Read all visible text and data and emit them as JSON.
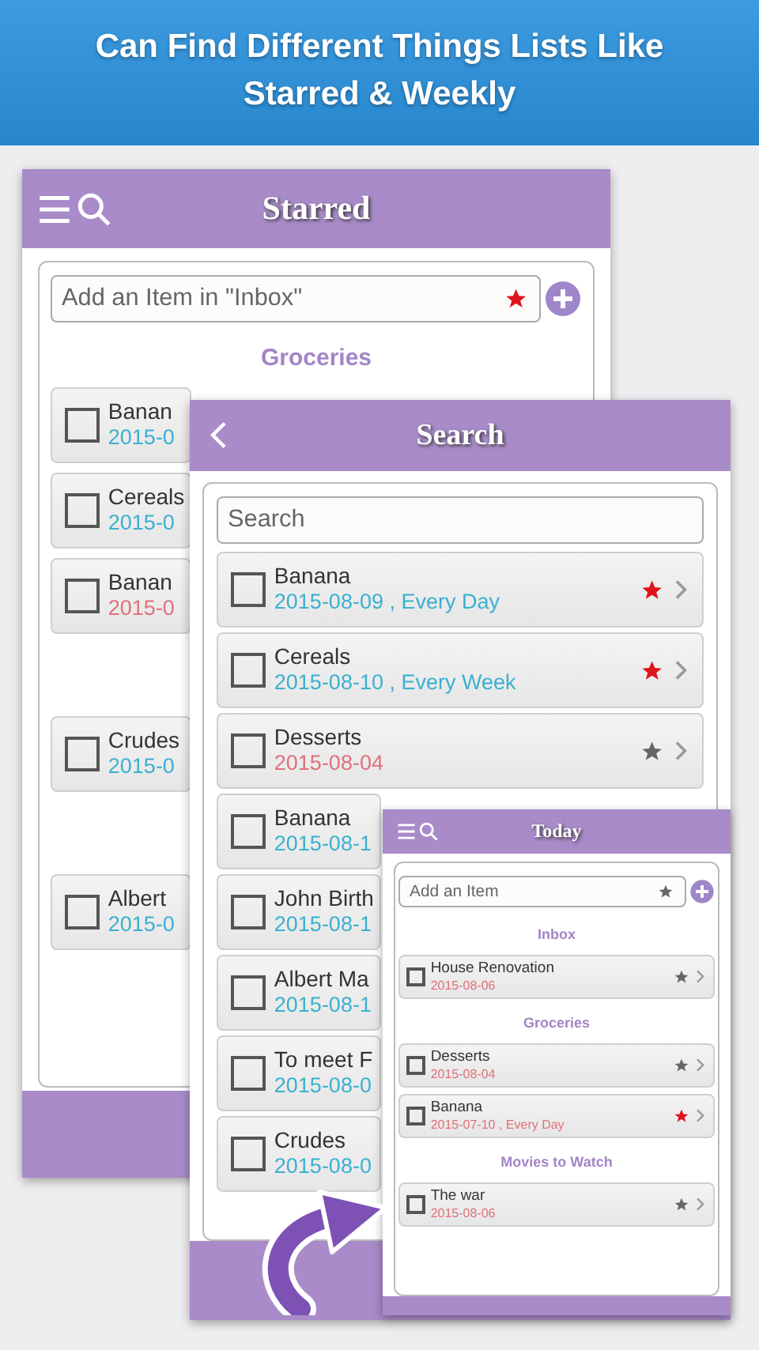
{
  "banner": {
    "lines": [
      "Can Find Different Things Lists Like",
      "Starred & Weekly"
    ]
  },
  "starred_screen": {
    "kind": "menu",
    "title": "Starred",
    "add_field": {
      "placeholder": "Add an Item in \"Inbox\"",
      "starred": true
    },
    "sections": [
      {
        "heading": "Groceries",
        "items": [
          {
            "title": "Banan",
            "date": "2015-0",
            "overdue": false,
            "checked": false
          },
          {
            "title": "Cereals",
            "date": "2015-0",
            "overdue": false,
            "checked": false
          },
          {
            "title": "Banan",
            "date": "2015-0",
            "overdue": true,
            "checked": false
          }
        ]
      },
      {
        "items": [
          {
            "title": "Crudes",
            "date": "2015-0",
            "overdue": false,
            "checked": false
          }
        ]
      },
      {
        "items": [
          {
            "title": "Albert",
            "date": "2015-0",
            "overdue": false,
            "checked": false
          }
        ]
      }
    ]
  },
  "search_screen": {
    "kind": "back",
    "title": "Search",
    "search_field": {
      "placeholder": "Search"
    },
    "sections": [
      {
        "items": [
          {
            "title": "Banana",
            "date": "2015-08-09 , Every Day",
            "overdue": false,
            "checked": false,
            "starred": true
          },
          {
            "title": "Cereals",
            "date": "2015-08-10 , Every Week",
            "overdue": false,
            "checked": false,
            "starred": true
          },
          {
            "title": "Desserts",
            "date": "2015-08-04",
            "overdue": true,
            "checked": false,
            "starred": false
          },
          {
            "title": "Banana",
            "date": "2015-08-1",
            "overdue": false,
            "checked": false
          },
          {
            "title": "John Birth",
            "date": "2015-08-1",
            "overdue": false,
            "checked": false
          },
          {
            "title": "Albert Ma",
            "date": "2015-08-1",
            "overdue": false,
            "checked": false
          },
          {
            "title": "To meet F",
            "date": "2015-08-0",
            "overdue": false,
            "checked": false
          },
          {
            "title": "Crudes",
            "date": "2015-08-0",
            "overdue": false,
            "checked": false
          }
        ]
      }
    ]
  },
  "today_screen": {
    "kind": "menu",
    "title": "Today",
    "add_field": {
      "placeholder": "Add an Item",
      "starred": false
    },
    "sections": [
      {
        "heading": "Inbox",
        "items": [
          {
            "title": "House Renovation",
            "date": "2015-08-06",
            "overdue": true,
            "checked": false,
            "starred": false
          }
        ]
      },
      {
        "heading": "Groceries",
        "items": [
          {
            "title": "Desserts",
            "date": "2015-08-04",
            "overdue": true,
            "checked": false,
            "starred": false
          },
          {
            "title": "Banana",
            "date": "2015-07-10 , Every Day",
            "overdue": true,
            "checked": false,
            "starred": true
          }
        ]
      },
      {
        "heading": "Movies to Watch",
        "items": [
          {
            "title": "The war",
            "date": "2015-08-06",
            "overdue": true,
            "checked": false,
            "starred": false
          }
        ]
      }
    ]
  }
}
